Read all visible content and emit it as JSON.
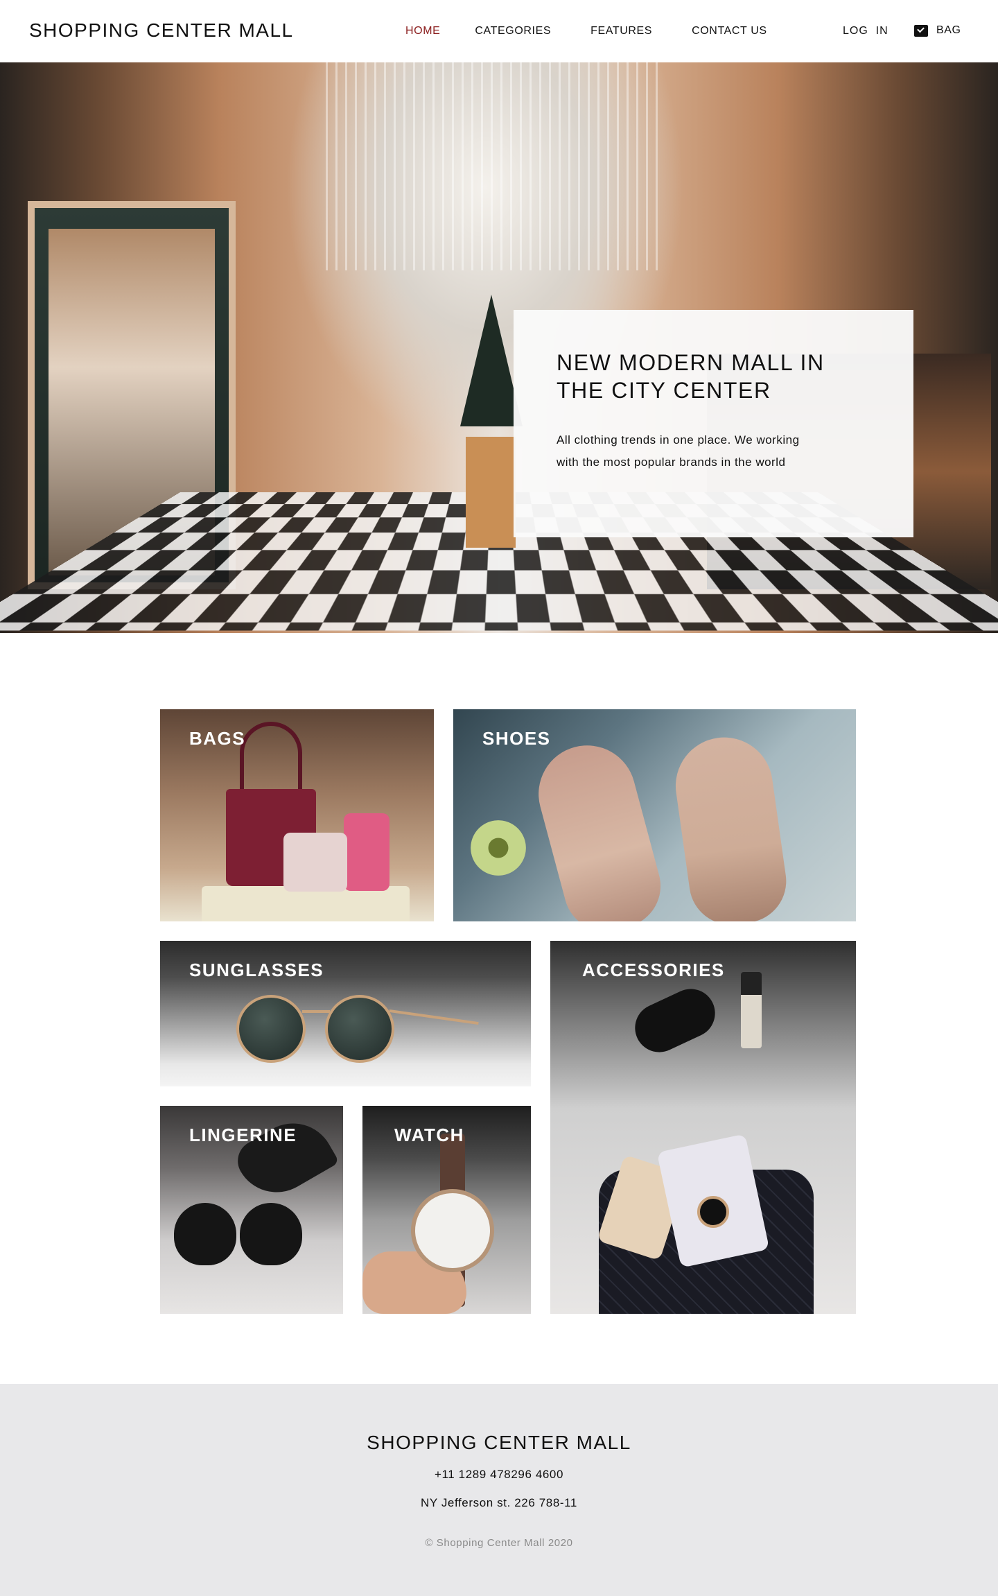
{
  "header": {
    "brand": "SHOPPING CENTER MALL",
    "nav": [
      {
        "label": "HOME",
        "active": true
      },
      {
        "label": "CATEGORIES",
        "active": false
      },
      {
        "label": "FEATURES",
        "active": false
      },
      {
        "label": "CONTACT US",
        "active": false
      }
    ],
    "login_label": "LOG  IN",
    "bag_label": "BAG",
    "bag_icon": "mail-icon",
    "active_color": "#8a1c1c"
  },
  "hero": {
    "title": "NEW MODERN MALL IN THE CITY CENTER",
    "text": "All clothing trends in one place. We working with the most popular brands in the world"
  },
  "categories": [
    {
      "label": "BAGS"
    },
    {
      "label": "SHOES"
    },
    {
      "label": "SUNGLASSES"
    },
    {
      "label": "ACCESSORIES"
    },
    {
      "label": "LINGERINE"
    },
    {
      "label": "WATCH"
    }
  ],
  "footer": {
    "brand": "SHOPPING CENTER MALL",
    "phone": "+11 1289 478296 4600",
    "address": "NY Jefferson st. 226 788-11",
    "copyright": "© Shopping Center Mall 2020",
    "background": "#e8e8ea"
  }
}
